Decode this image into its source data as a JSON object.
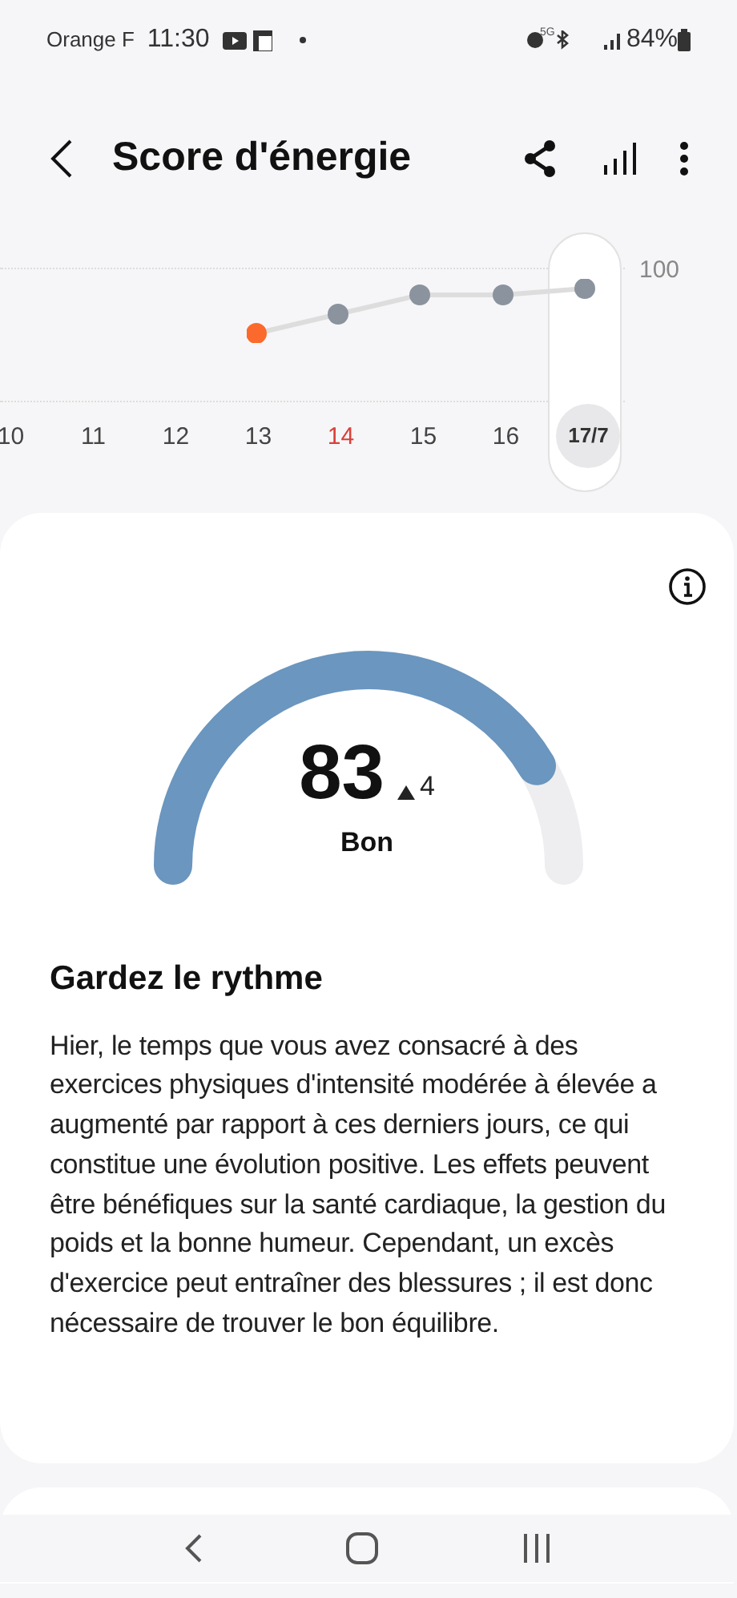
{
  "status_bar": {
    "carrier": "Orange F",
    "time": "11:30",
    "network": "5G",
    "battery": "84%"
  },
  "header": {
    "title": "Score d'énergie"
  },
  "trend": {
    "max_label": "100",
    "days": [
      {
        "label": "10",
        "weekend": false,
        "selected": false
      },
      {
        "label": "11",
        "weekend": false,
        "selected": false
      },
      {
        "label": "12",
        "weekend": false,
        "selected": false
      },
      {
        "label": "13",
        "weekend": false,
        "selected": false
      },
      {
        "label": "14",
        "weekend": true,
        "selected": false
      },
      {
        "label": "15",
        "weekend": false,
        "selected": false
      },
      {
        "label": "16",
        "weekend": false,
        "selected": false
      },
      {
        "label": "17/7",
        "weekend": false,
        "selected": true
      }
    ]
  },
  "score": {
    "value": "83",
    "change": "4",
    "rating": "Bon"
  },
  "advice": {
    "title": "Gardez le rythme",
    "body": "Hier, le temps que vous avez consacré à des exercices physiques d'intensité modérée à élevée a augmenté par rapport à ces derniers jours, ce qui constitue une évolution positive. Les effets peuvent être bénéfiques sur la santé cardiaque, la gestion du poids et la bonne humeur. Cependant, un excès d'exercice peut entraîner des blessures ; il est donc nécessaire de trouver le bon équilibre."
  }
}
